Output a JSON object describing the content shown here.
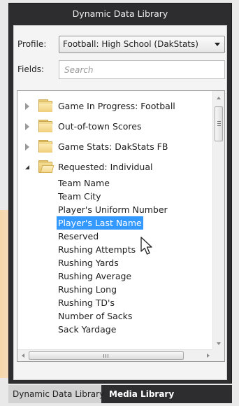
{
  "panel": {
    "title": "Dynamic Data Library"
  },
  "profile": {
    "label": "Profile:",
    "selected": "Football: High School (DakStats)"
  },
  "fields": {
    "label": "Fields:",
    "search_placeholder": "Search",
    "search_value": ""
  },
  "tree": {
    "folders": [
      {
        "label": "Game In Progress: Football",
        "expanded": false
      },
      {
        "label": "Out-of-town Scores",
        "expanded": false
      },
      {
        "label": "Game Stats: DakStats FB",
        "expanded": false
      },
      {
        "label": "Requested: Individual",
        "expanded": true
      }
    ],
    "items": [
      "Team Name",
      "Team City",
      "Player's Uniform Number",
      "Player's Last Name",
      "Reserved",
      "Rushing Attempts",
      "Rushing Yards",
      "Rushing Average",
      "Rushing Long",
      "Rushing TD's",
      "Number of Sacks",
      "Sack Yardage"
    ],
    "selected_item": "Player's Last Name"
  },
  "tabs": {
    "dynamic_data": "Dynamic Data Library",
    "media": "Media Library",
    "active": "Dynamic Data Library"
  },
  "colors": {
    "panel_dark": "#2d2d30",
    "selection": "#3399ff",
    "folder": "#f0cf7a"
  }
}
